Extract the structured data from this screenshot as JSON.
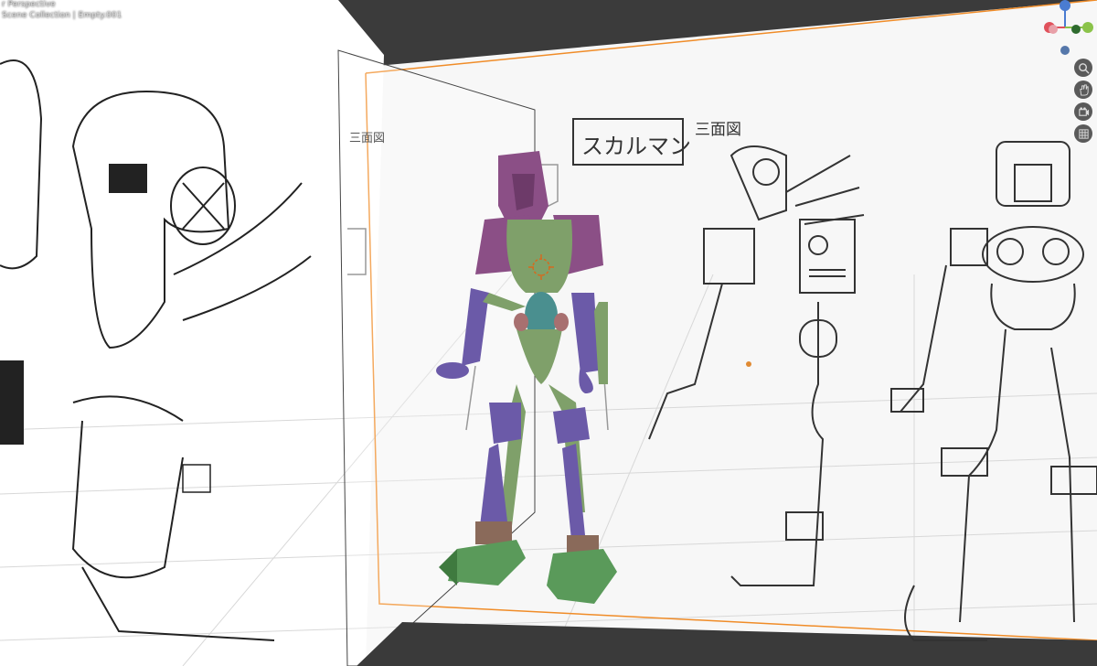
{
  "viewport": {
    "header_line": "r Perspective",
    "collection_line": "Scene Collection | Empty.001"
  },
  "sheet": {
    "title_box": "スカルマン",
    "subtitle": "三面図",
    "left_note": "三面図"
  },
  "gizmo": {
    "axes": [
      "X",
      "Y",
      "Z"
    ],
    "colors": {
      "x": "#e0515b",
      "y": "#8bc34a",
      "z": "#4a7cd1"
    }
  },
  "nav_tools": [
    "zoom-icon",
    "hand-icon",
    "camera-icon",
    "grid-icon"
  ],
  "colors": {
    "viewport_bg": "#3b3b3b",
    "selection": "#f08c28",
    "head": "#8b4f86",
    "body": "#7fa06a",
    "limbs": "#6b5aa8",
    "feet": "#5a9a5a"
  }
}
